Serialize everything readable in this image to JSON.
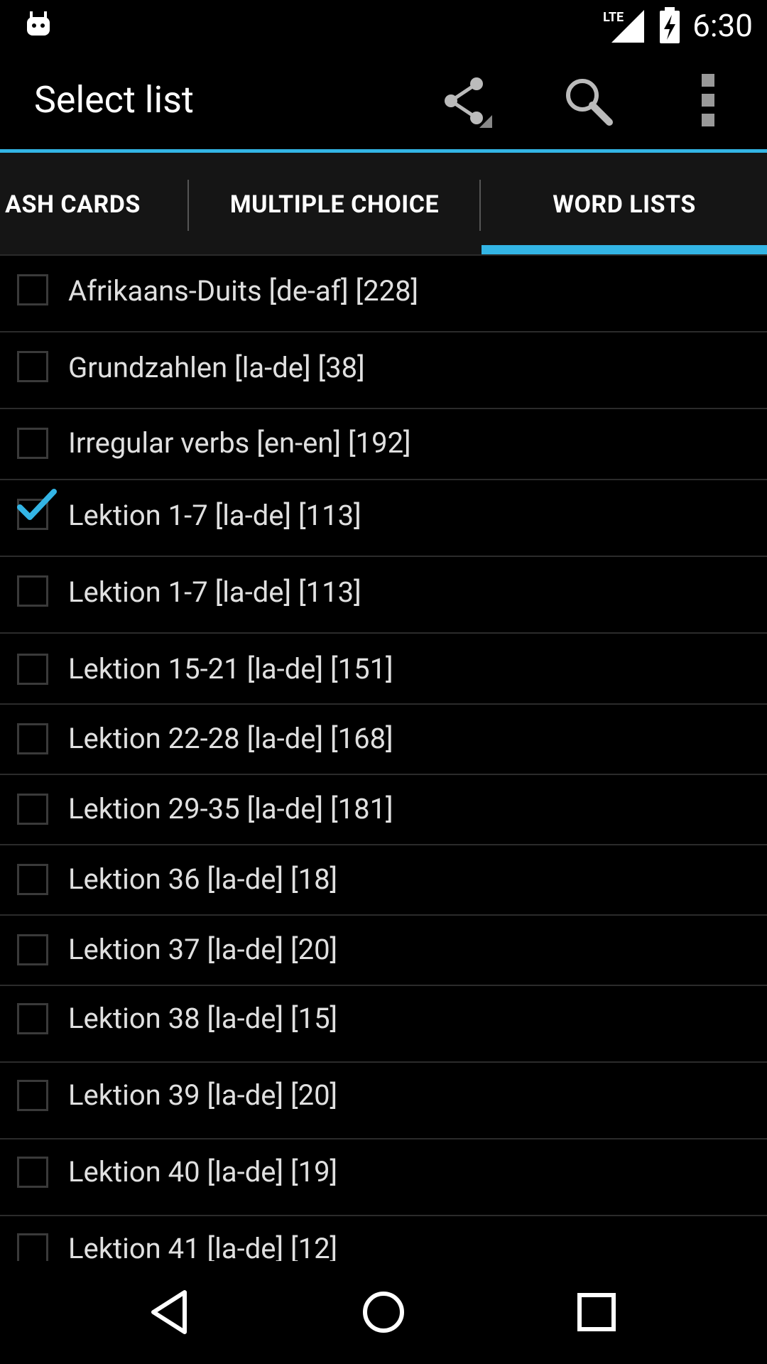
{
  "status_bar": {
    "network": "LTE",
    "time": "6:30"
  },
  "action_bar": {
    "title": "Select list",
    "icons": [
      "share-icon",
      "search-icon",
      "overflow-menu-icon"
    ]
  },
  "tabs": [
    {
      "label": "ASH CARDS",
      "selected": false
    },
    {
      "label": "MULTIPLE CHOICE",
      "selected": false
    },
    {
      "label": "WORD LISTS",
      "selected": true
    }
  ],
  "colors": {
    "accent": "#33b5e5",
    "background": "#000000",
    "tab_background": "#151515"
  },
  "word_lists": [
    {
      "label": "Afrikaans-Duits [de-af] [228]",
      "checked": false
    },
    {
      "label": "Grundzahlen [la-de] [38]",
      "checked": false
    },
    {
      "label": "Irregular verbs [en-en] [192]",
      "checked": false
    },
    {
      "label": "Lektion 1-7 [la-de] [113]",
      "checked": true
    },
    {
      "label": "Lektion 1-7 [la-de] [113]",
      "checked": false
    },
    {
      "label": "Lektion 15-21 [la-de] [151]",
      "checked": false
    },
    {
      "label": "Lektion 22-28 [la-de] [168]",
      "checked": false
    },
    {
      "label": "Lektion 29-35 [la-de] [181]",
      "checked": false
    },
    {
      "label": "Lektion 36 [la-de] [18]",
      "checked": false
    },
    {
      "label": "Lektion 37 [la-de] [20]",
      "checked": false
    },
    {
      "label": "Lektion 38 [la-de] [15]",
      "checked": false
    },
    {
      "label": "Lektion 39 [la-de] [20]",
      "checked": false
    },
    {
      "label": "Lektion 40 [la-de] [19]",
      "checked": false
    },
    {
      "label": "Lektion 41 [la-de] [12]",
      "checked": false
    }
  ],
  "nav_bar": [
    "back-icon",
    "home-icon",
    "recents-icon"
  ]
}
